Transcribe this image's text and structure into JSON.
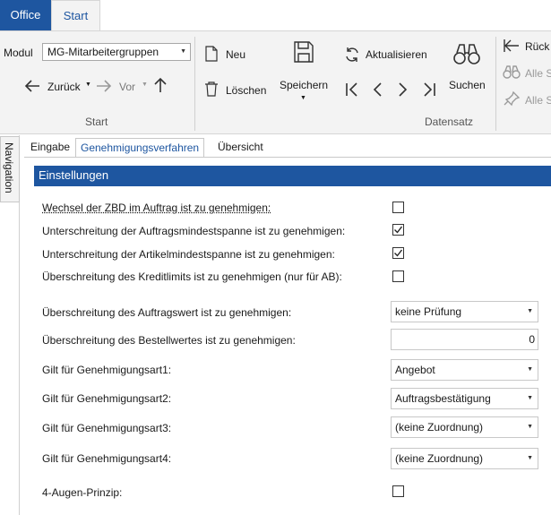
{
  "tabs": {
    "office": "Office",
    "start": "Start"
  },
  "ribbon": {
    "modul_label": "Modul",
    "modul_value": "MG-Mitarbeitergruppen",
    "back_label": "Zurück",
    "forward_label": "Vor",
    "group_start": "Start",
    "neu": "Neu",
    "loeschen": "Löschen",
    "speichern": "Speichern",
    "aktualisieren": "Aktualisieren",
    "suchen": "Suchen",
    "group_datensatz": "Datensatz",
    "rueck": "Rück",
    "alle_s1": "Alle S",
    "alle_s2": "Alle S"
  },
  "navigation_label": "Navigation",
  "content_tabs": [
    "Eingabe",
    "Genehmigungsverfahren",
    "Übersicht"
  ],
  "section_title": "Einstellungen",
  "rows": [
    {
      "label": "Wechsel der ZBD im Auftrag ist zu genehmigen:",
      "checked": false
    },
    {
      "label": "Unterschreitung der Auftragsmindestspanne ist zu genehmigen:",
      "checked": true
    },
    {
      "label": "Unterschreitung der Artikelmindestspanne ist zu genehmigen:",
      "checked": true
    },
    {
      "label": "Überschreitung des Kreditlimits ist zu genehmigen (nur für AB):",
      "checked": false
    }
  ],
  "fields": [
    {
      "label": "Überschreitung des Auftragswert ist zu genehmigen:",
      "value": "keine Prüfung"
    },
    {
      "label": "Überschreitung des Bestellwertes ist zu genehmigen:",
      "value": "0"
    },
    {
      "label": "Gilt für Genehmigungsart1:",
      "value": "Angebot"
    },
    {
      "label": "Gilt für Genehmigungsart2:",
      "value": "Auftragsbestätigung"
    },
    {
      "label": "Gilt für Genehmigungsart3:",
      "value": "(keine Zuordnung)"
    },
    {
      "label": "Gilt für Genehmigungsart4:",
      "value": "(keine Zuordnung)"
    }
  ],
  "vier_augen": {
    "label": "4-Augen-Prinzip:",
    "checked": false
  },
  "colors": {
    "accent": "#1e56a0",
    "ribbon_bg": "#f3f3f3"
  }
}
